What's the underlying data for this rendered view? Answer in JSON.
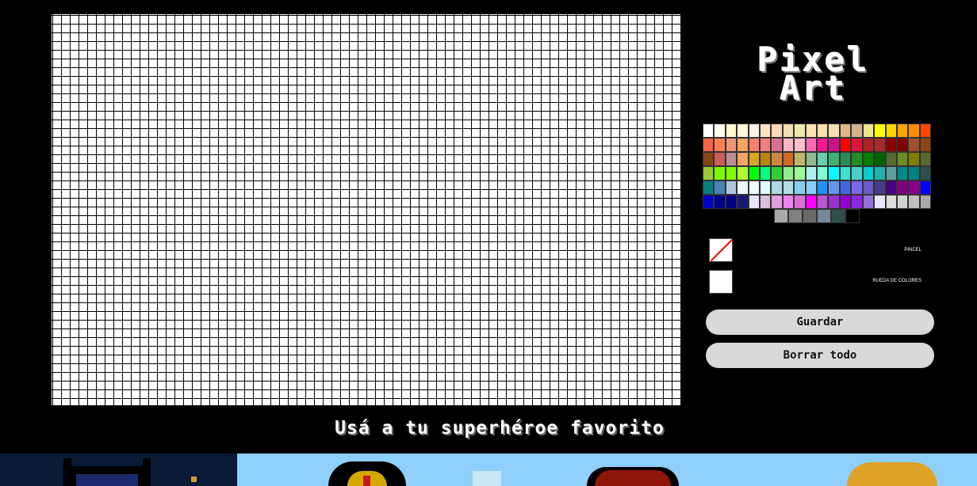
{
  "app": {
    "title_line1": "Pixel",
    "title_line2": "Art"
  },
  "palette": {
    "rows": [
      [
        "#ffffff",
        "#fffff0",
        "#fffacd",
        "#fff8dc",
        "#faf0e6",
        "#ffe4c4",
        "#ffdab9",
        "#f5deb3",
        "#eee8aa",
        "#ffe4b5",
        "#ffdead",
        "#f5deb3",
        "#deb887",
        "#d2b48c",
        "#f0e68c",
        "#ffff00",
        "#ffd700",
        "#ffa500",
        "#ff8c00",
        "#ff4500"
      ],
      [
        "#ff6347",
        "#ff7f50",
        "#e9967a",
        "#f4a460",
        "#fa8072",
        "#f08080",
        "#db7093",
        "#ffb6c1",
        "#ffc0cb",
        "#ff69b4",
        "#ff1493",
        "#c71585",
        "#ff0000",
        "#dc143c",
        "#b22222",
        "#a52a2a",
        "#8b0000",
        "#800000",
        "#a0522d",
        "#8b4513"
      ],
      [
        "#8b4513",
        "#cd5c5c",
        "#bc8f8f",
        "#f4a460",
        "#daa520",
        "#b8860b",
        "#cd853f",
        "#d2691e",
        "#bdb76b",
        "#8fbc8f",
        "#66cdaa",
        "#3cb371",
        "#2e8b57",
        "#228b22",
        "#008000",
        "#006400",
        "#556b2f",
        "#6b8e23",
        "#808000",
        "#556b2f"
      ],
      [
        "#9acd32",
        "#7cfc00",
        "#7fff00",
        "#adff2f",
        "#00ff00",
        "#00ff7f",
        "#32cd32",
        "#90ee90",
        "#98fb98",
        "#afeeee",
        "#7fffd4",
        "#00ffff",
        "#40e0d0",
        "#48d1cc",
        "#00ced1",
        "#20b2aa",
        "#5f9ea0",
        "#008b8b",
        "#008080",
        "#2f4f4f"
      ],
      [
        "#008080",
        "#4682b4",
        "#b0c4de",
        "#f0f8ff",
        "#f0ffff",
        "#e0ffff",
        "#add8e6",
        "#b0e0e6",
        "#87ceeb",
        "#87cefa",
        "#1e90ff",
        "#6495ed",
        "#4169e1",
        "#7b68ee",
        "#6a5acd",
        "#483d8b",
        "#4b0082",
        "#800080",
        "#8b008b",
        "#0000ff"
      ],
      [
        "#0000cd",
        "#00008b",
        "#000080",
        "#191970",
        "#e6e6fa",
        "#d8bfd8",
        "#dda0dd",
        "#ee82ee",
        "#da70d6",
        "#ff00ff",
        "#ba55d3",
        "#9932cc",
        "#9400d3",
        "#8a2be2",
        "#9370db",
        "#e6e6fa",
        "#dcdcdc",
        "#d3d3d3",
        "#c0c0c0",
        "#a9a9a9"
      ]
    ],
    "last_row": [
      "#a9a9a9",
      "#808080",
      "#696969",
      "#778899",
      "#2f4f4f",
      "#000000"
    ]
  },
  "tools": {
    "brush_label": "PINCEL",
    "wheel_label": "RUEDA DE COLORES"
  },
  "buttons": {
    "save": "Guardar",
    "clear": "Borrar todo"
  },
  "subtitle": "Usá a tu superhéroe favorito"
}
